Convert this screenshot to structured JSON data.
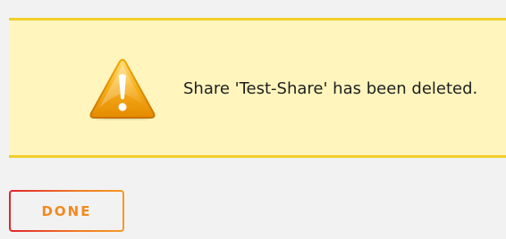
{
  "notice": {
    "icon": "warning-triangle-icon",
    "message": "Share 'Test-Share' has been deleted.",
    "background_color": "#fff5bd",
    "border_color": "#f2cf2a"
  },
  "actions": {
    "done_label": "DONE",
    "done_label_color": "#f28a1e",
    "done_border_gradient": [
      "#e2232d",
      "#f59a23"
    ]
  }
}
